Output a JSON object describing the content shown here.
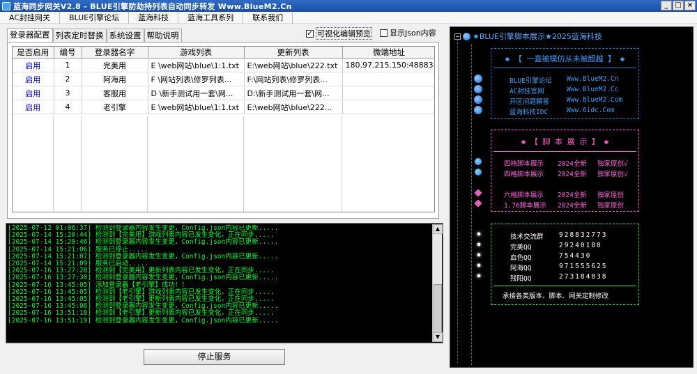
{
  "window": {
    "title": "蓝海同步网关V2.8 - BLUE引擎防劫持列表自动同步转发 Www.BlueM2.Cn",
    "minimize": "_",
    "maximize": "□",
    "close": "×"
  },
  "menu": [
    "AC封挂网关",
    "BLUE引擎论坛",
    "蓝海科技",
    "蓝海工具系列",
    "联系我们"
  ],
  "tabs": [
    "登录器配置",
    "列表定时替换",
    "系统设置",
    "帮助说明"
  ],
  "options": {
    "visual_edit": "可视化编辑预览",
    "visual_edit_checked": true,
    "show_json": "显示Json内容",
    "show_json_checked": false
  },
  "table": {
    "headers": [
      "是否启用",
      "编号",
      "登录器名字",
      "游戏列表",
      "更新列表",
      "微端地址"
    ],
    "rows": [
      {
        "enabled": "启用",
        "id": "1",
        "name": "完美用",
        "game_list": "E \\web网站\\blue\\1:1.txt",
        "update_list": "E:\\web网站\\blue\\222.txt",
        "micro": "180.97.215.150:48883"
      },
      {
        "enabled": "启用",
        "id": "2",
        "name": "阿海用",
        "game_list": "F \\网站列表\\修罗列表...",
        "update_list": "F:\\网站列表\\修罗列表...",
        "micro": ""
      },
      {
        "enabled": "启用",
        "id": "3",
        "name": "客服用",
        "game_list": "D \\新手测试用一套\\网...",
        "update_list": "D:\\新手测试用一套\\网...",
        "micro": ""
      },
      {
        "enabled": "启用",
        "id": "4",
        "name": "老引擎",
        "game_list": "E \\web网站\\blue\\1:1.txt",
        "update_list": "E:\\web网站\\blue\\222...",
        "micro": ""
      }
    ]
  },
  "log": [
    "[2025-07-12 01:06:37] 检测到登录器内容发生变更，Config.json内容已更新.....",
    "[2025-07-14 15:20:44] 检测到【完美用】游戏列表内容已发生变化，正在同步.....",
    "[2025-07-14 15:20:46] 检测到登录器内容发生变更，Config.json内容已更新.....",
    "[2025-07-14 15:21:06] 服务已停止.....",
    "[2025-07-14 15:21:07] 检测到登录器内容发生变更，Config.json内容已更新.....",
    "[2025-07-14 15:21:09] 服务已启动.....",
    "[2025-07-16 13:27:28] 检测到【完美用】更新列表内容已发生变化，正在同步.....",
    "[2025-07-16 13:27:30] 检测到登录器内容发生变更，Config.json内容已更新.....",
    "[2025-07-16 13:45:05] 添加登录器【老引擎】成功！！",
    "[2025-07-16 13:45:05] 检测到【老引擎】游戏列表内容已发生变化，正在同步.....",
    "[2025-07-16 13:45:05] 检测到【老引擎】更新列表内容已发生变化，正在同步.....",
    "[2025-07-16 13:45:06] 检测到登录器内容发生变更，Config.json内容已更新.....",
    "[2025-07-16 13:51:18] 检测到【老引擎】更新列表内容已发生变化，正在同步.....",
    "[2025-07-16 13:51:19] 检测到登录器内容发生变更，Config.json内容已更新....."
  ],
  "stop_button": "停止服务",
  "panel": {
    "root": "★BLUE引擎脚本展示★2025蓝海科技",
    "box1_title": "◆ 【 一直被模仿从未被超越 】 ◆",
    "links": [
      {
        "name": "BLUE引擎论坛",
        "url": "Www.BlueM2.Cn"
      },
      {
        "name": "AC封挂官网",
        "url": "Www.BlueM2.Cc"
      },
      {
        "name": "开区问题解答",
        "url": "Www.BlueM2.Com"
      },
      {
        "name": "蓝海科技IDC",
        "url": "Www.6idc.Com"
      }
    ],
    "box2_title": "◆ 【 脚 本 展 示 】 ◆",
    "scripts": [
      {
        "name": "四格脚本展示",
        "year": "2024全新",
        "tag": "独家原创√"
      },
      {
        "name": "四格脚本展示",
        "year": "2024全新",
        "tag": "独家原创√"
      },
      {
        "name": "六格脚本展示",
        "year": "2024全新",
        "tag": "独家原创"
      },
      {
        "name": "1.76脚本展示",
        "year": "2024全新",
        "tag": "独家原创"
      }
    ],
    "contacts": [
      {
        "label": "技术交流群",
        "value": "928832773"
      },
      {
        "label": "完美QQ",
        "value": "29240180"
      },
      {
        "label": "血色QQ",
        "value": "754430"
      },
      {
        "label": "阿海QQ",
        "value": "971555625"
      },
      {
        "label": "残阳QQ",
        "value": "273184838"
      }
    ],
    "box3_footer": "承接各类版本、脚本、网关定制修改",
    "colors": {
      "blue": "#2277cc",
      "pink": "#ff55cc",
      "green": "#33dd33",
      "log": "#00ff33"
    }
  }
}
